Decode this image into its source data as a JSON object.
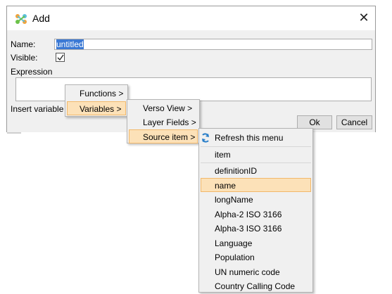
{
  "window": {
    "title": "Add",
    "close_glyph": "✕",
    "icon": "app-logo-icon"
  },
  "form": {
    "name_label": "Name:",
    "name_value": "untitled",
    "visible_label": "Visible:",
    "visible_checked": true,
    "expression_label": "Expression",
    "insert_variable_label": "Insert variable"
  },
  "buttons": {
    "ok": "Ok",
    "cancel": "Cancel"
  },
  "menu1": {
    "items": [
      {
        "label": "Functions >",
        "highlighted": false
      },
      {
        "label": "Variables >",
        "highlighted": true
      }
    ]
  },
  "menu2": {
    "items": [
      {
        "label": "Verso View >",
        "highlighted": false
      },
      {
        "label": "Layer Fields >",
        "highlighted": false
      },
      {
        "label": "Source item >",
        "highlighted": true
      }
    ]
  },
  "menu3": {
    "refresh": {
      "label": "Refresh this menu",
      "icon": "refresh-icon"
    },
    "items": [
      {
        "label": "item",
        "highlighted": false
      },
      {
        "label": "definitionID",
        "highlighted": false
      },
      {
        "label": "name",
        "highlighted": true
      },
      {
        "label": "longName",
        "highlighted": false
      },
      {
        "label": "Alpha-2 ISO 3166",
        "highlighted": false
      },
      {
        "label": "Alpha-3 ISO 3166",
        "highlighted": false
      },
      {
        "label": "Language",
        "highlighted": false
      },
      {
        "label": "Population",
        "highlighted": false
      },
      {
        "label": "UN numeric code",
        "highlighted": false
      },
      {
        "label": "Country Calling Code",
        "highlighted": false
      }
    ]
  },
  "colors": {
    "highlight_bg": "#fce1b8",
    "highlight_border": "#f2b86a",
    "selection": "#3a78d4"
  }
}
